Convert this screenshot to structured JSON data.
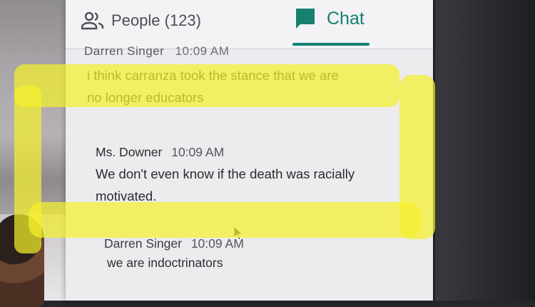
{
  "tabs": {
    "people_label": "People (123)",
    "chat_label": "Chat",
    "active": "chat"
  },
  "messages": {
    "partial_header": {
      "sender": "Darren Singer",
      "time": "10:09 AM"
    },
    "m1": {
      "text_line1": "i think carranza took the stance that we are",
      "text_line2": "no longer educators"
    },
    "m2": {
      "sender": "Ms. Downer",
      "time": "10:09 AM",
      "text_line1": "We don't even know if the death was racially",
      "text_line2": "motivated."
    },
    "m3": {
      "sender": "Darren Singer",
      "time": "10:09 AM",
      "text": "we are indoctrinators"
    }
  },
  "colors": {
    "accent": "#138174",
    "highlight": "#f4f02d",
    "panel_bg": "#ecebee"
  },
  "icons": {
    "people": "people-icon",
    "chat": "chat-bubble-icon",
    "cursor": "mouse-pointer-icon"
  }
}
